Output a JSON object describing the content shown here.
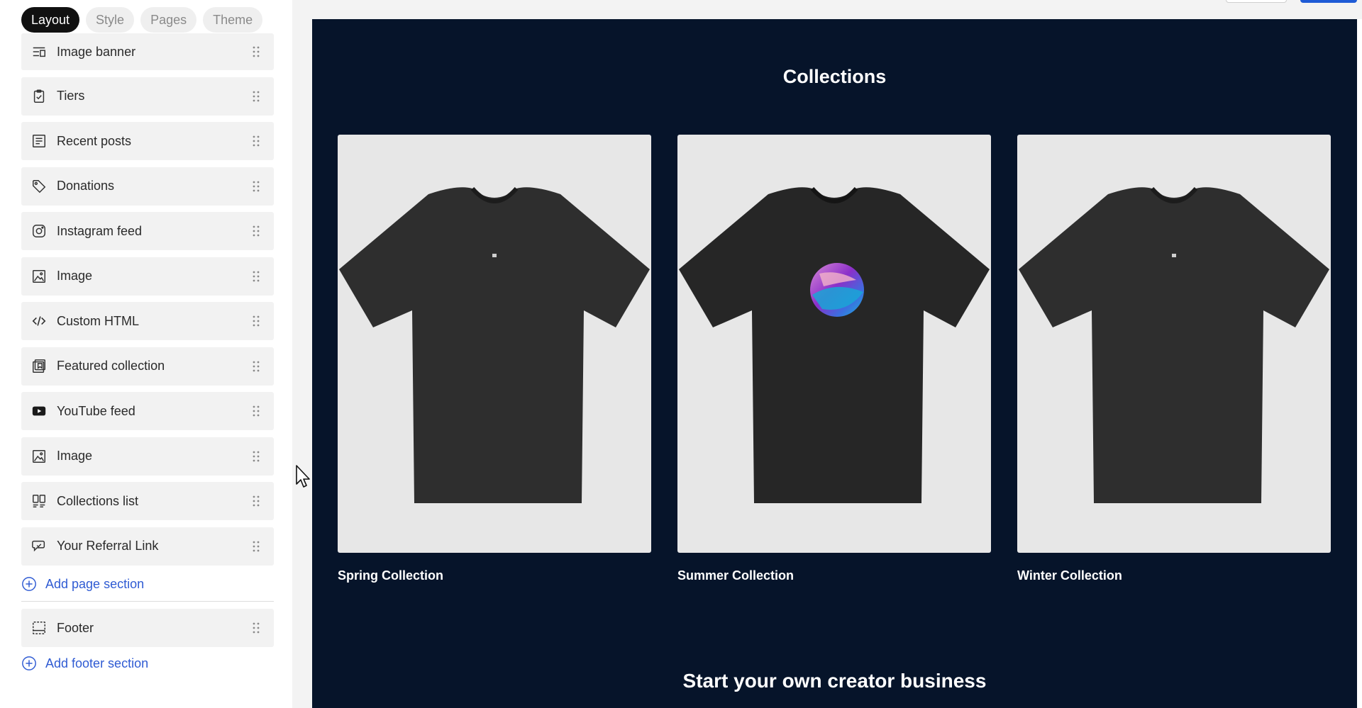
{
  "tabs": [
    {
      "label": "Layout",
      "active": true
    },
    {
      "label": "Style",
      "active": false
    },
    {
      "label": "Pages",
      "active": false
    },
    {
      "label": "Theme",
      "active": false
    }
  ],
  "sidebar": {
    "sections": [
      {
        "label": "Image banner",
        "icon": "image-banner-icon"
      },
      {
        "label": "Tiers",
        "icon": "tiers-icon"
      },
      {
        "label": "Recent posts",
        "icon": "recent-posts-icon"
      },
      {
        "label": "Donations",
        "icon": "tag-icon"
      },
      {
        "label": "Instagram feed",
        "icon": "instagram-icon"
      },
      {
        "label": "Image",
        "icon": "image-icon"
      },
      {
        "label": "Custom HTML",
        "icon": "code-icon"
      },
      {
        "label": "Featured collection",
        "icon": "featured-collection-icon"
      },
      {
        "label": "YouTube feed",
        "icon": "youtube-icon"
      },
      {
        "label": "Image",
        "icon": "image-icon"
      },
      {
        "label": "Collections list",
        "icon": "collections-list-icon"
      },
      {
        "label": "Your Referral Link",
        "icon": "referral-link-icon"
      }
    ],
    "add_page_section": "Add page section",
    "footer_section": {
      "label": "Footer",
      "icon": "footer-icon"
    },
    "add_footer_section": "Add footer section"
  },
  "preview": {
    "collections_title": "Collections",
    "collections": [
      {
        "name": "Spring Collection",
        "graphic": "small-logo"
      },
      {
        "name": "Summer Collection",
        "graphic": "gradient-circle"
      },
      {
        "name": "Winter Collection",
        "graphic": "small-logo"
      }
    ],
    "cta_title": "Start your own creator business"
  },
  "colors": {
    "accent": "#2f5bd3",
    "preview_background": "#06142a",
    "active_tab": "#111111",
    "shirt": "#2e2e2e"
  }
}
